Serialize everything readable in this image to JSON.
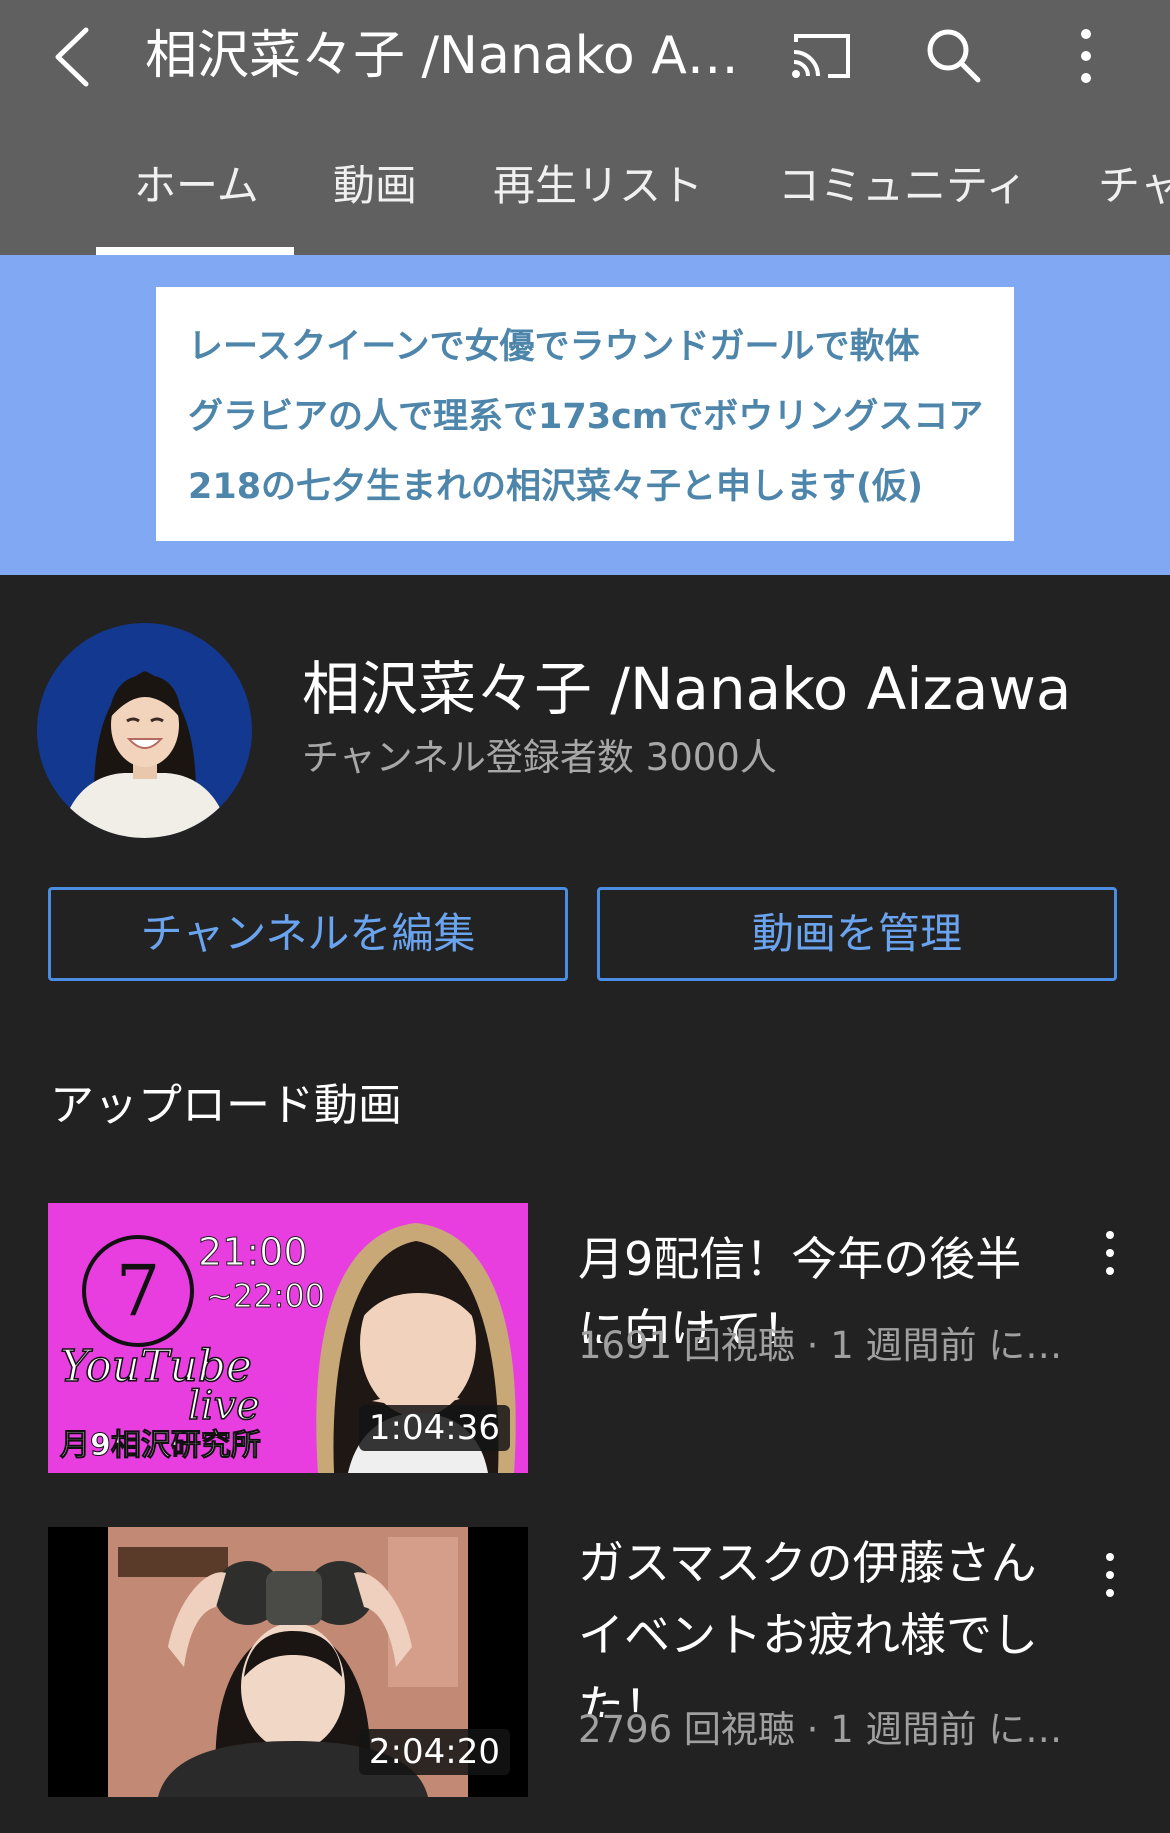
{
  "header": {
    "title": "相沢菜々子 /Nanako A…"
  },
  "tabs": [
    {
      "label": "ホーム"
    },
    {
      "label": "動画"
    },
    {
      "label": "再生リスト"
    },
    {
      "label": "コミュニティ"
    },
    {
      "label": "チャ"
    }
  ],
  "banner": {
    "lines": [
      "レースクイーンで女優でラウンドガールで軟体",
      "グラビアの人で理系で173cmでボウリングスコア",
      "218の七夕生まれの相沢菜々子と申します(仮)"
    ]
  },
  "channel": {
    "name": "相沢菜々子 /Nanako Aizawa",
    "subscribers": "チャンネル登録者数 3000人",
    "edit_button": "チャンネルを編集",
    "manage_button": "動画を管理"
  },
  "section": {
    "title": "アップロード動画"
  },
  "videos": [
    {
      "title": "月9配信！今年の後半に向けて！",
      "meta": "1691 回視聴 · 1 週間前 に…",
      "duration": "1:04:36",
      "thumb_text": {
        "number": "7",
        "time_start": "21:00",
        "time_end": "~22:00",
        "youtube": "YouTube",
        "live": "live",
        "caption": "月9相沢研究所"
      }
    },
    {
      "title": "ガスマスクの伊藤さんイベントお疲れ様でした！",
      "meta": "2796 回視聴 · 1 週間前 に…",
      "duration": "2:04:20"
    }
  ],
  "colors": {
    "topbar": "#606060",
    "background": "#222222",
    "banner": "#81a9f3",
    "banner_text": "#4e86ab",
    "button_border": "#4b8de0",
    "thumb_magenta": "#e83ee0"
  }
}
